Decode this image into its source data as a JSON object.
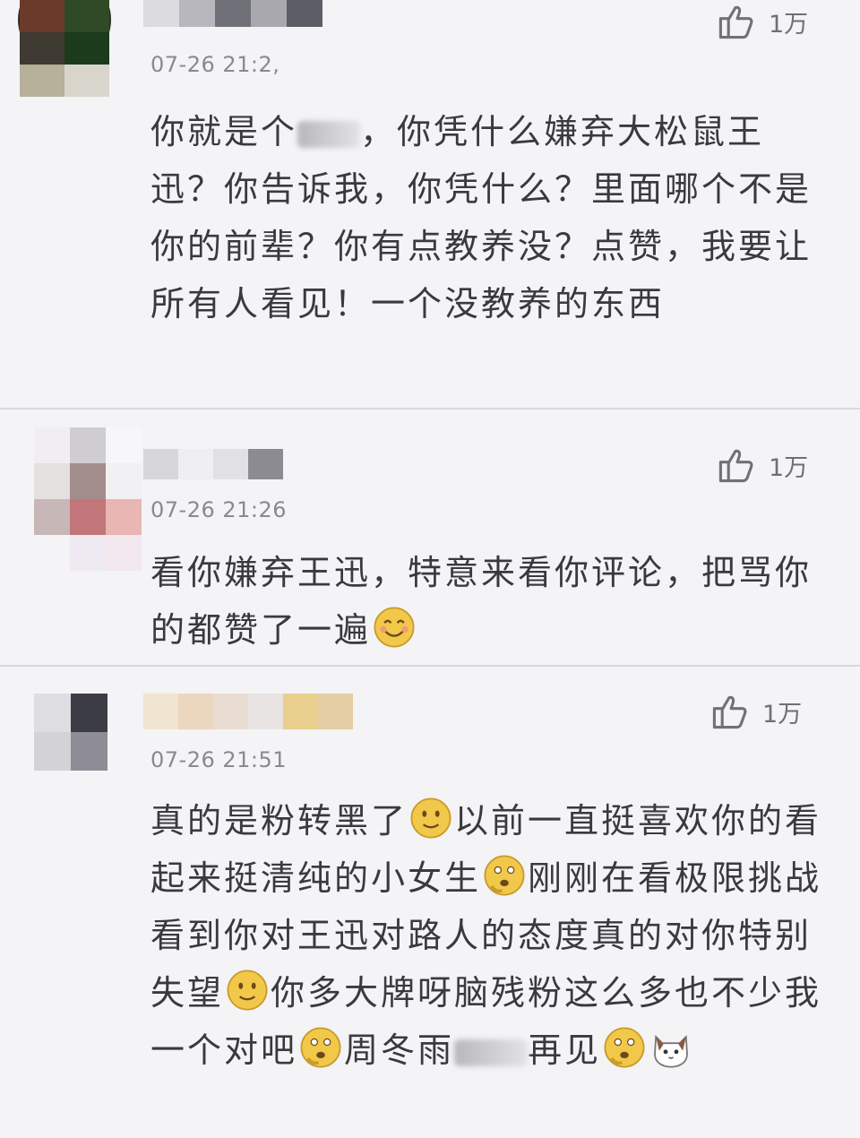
{
  "comments": [
    {
      "time": "07-26 21:2,",
      "likes": "1万",
      "text_parts": [
        "你就是个",
        "，你凭什么嫌弃大松鼠王迅？你告诉我，你凭什么？里面哪个不是你的前辈？你有点教养没？点赞，我要让所有人看见！一个没教养的东西"
      ]
    },
    {
      "time": "07-26 21:26",
      "likes": "1万",
      "text": "看你嫌弃王迅，特意来看你评论，把骂你的都赞了一遍"
    },
    {
      "time": "07-26 21:51",
      "likes": "1万",
      "text_parts": [
        "真的是粉转黑了",
        "以前一直挺喜欢你的看起来挺清纯的小女生",
        "刚刚在看极限挑战看到你对王迅对路人的态度真的对你特别失望",
        "你多大牌呀脑残粉这么多也不少我一个对吧",
        "周冬雨",
        "再见"
      ]
    }
  ],
  "icons": {
    "like": "thumbs-up-icon",
    "smile": "smile-emoji-icon",
    "think": "thinking-emoji-icon",
    "cat": "cat-face-icon"
  },
  "colors": {
    "background": "#f4f3f6",
    "text": "#3a3a3c",
    "meta": "#8a8a8e",
    "emoji": "#f2c84a"
  }
}
